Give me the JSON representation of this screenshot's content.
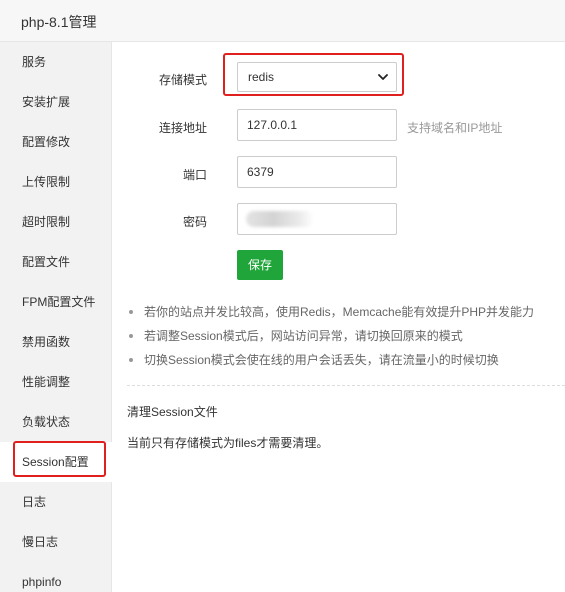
{
  "window": {
    "title": "php-8.1管理"
  },
  "sidebar": {
    "items": [
      {
        "label": "服务"
      },
      {
        "label": "安装扩展"
      },
      {
        "label": "配置修改"
      },
      {
        "label": "上传限制"
      },
      {
        "label": "超时限制"
      },
      {
        "label": "配置文件"
      },
      {
        "label": "FPM配置文件"
      },
      {
        "label": "禁用函数"
      },
      {
        "label": "性能调整"
      },
      {
        "label": "负载状态"
      },
      {
        "label": "Session配置"
      },
      {
        "label": "日志"
      },
      {
        "label": "慢日志"
      },
      {
        "label": "phpinfo"
      }
    ],
    "active": "Session配置"
  },
  "form": {
    "storage_mode_label": "存储模式",
    "storage_mode_value": "redis",
    "address_label": "连接地址",
    "address_value": "127.0.0.1",
    "address_hint": "支持域名和IP地址",
    "port_label": "端口",
    "port_value": "6379",
    "password_label": "密码",
    "save_label": "保存"
  },
  "tips": [
    "若你的站点并发比较高，使用Redis，Memcache能有效提升PHP并发能力",
    "若调整Session模式后，网站访问异常，请切换回原来的模式",
    "切换Session模式会使在线的用户会话丢失，请在流量小的时候切换"
  ],
  "cleanup": {
    "title": "清理Session文件",
    "description": "当前只有存储模式为files才需要清理。"
  },
  "colors": {
    "primary": "#20a53a",
    "highlight": "#e0201e"
  }
}
